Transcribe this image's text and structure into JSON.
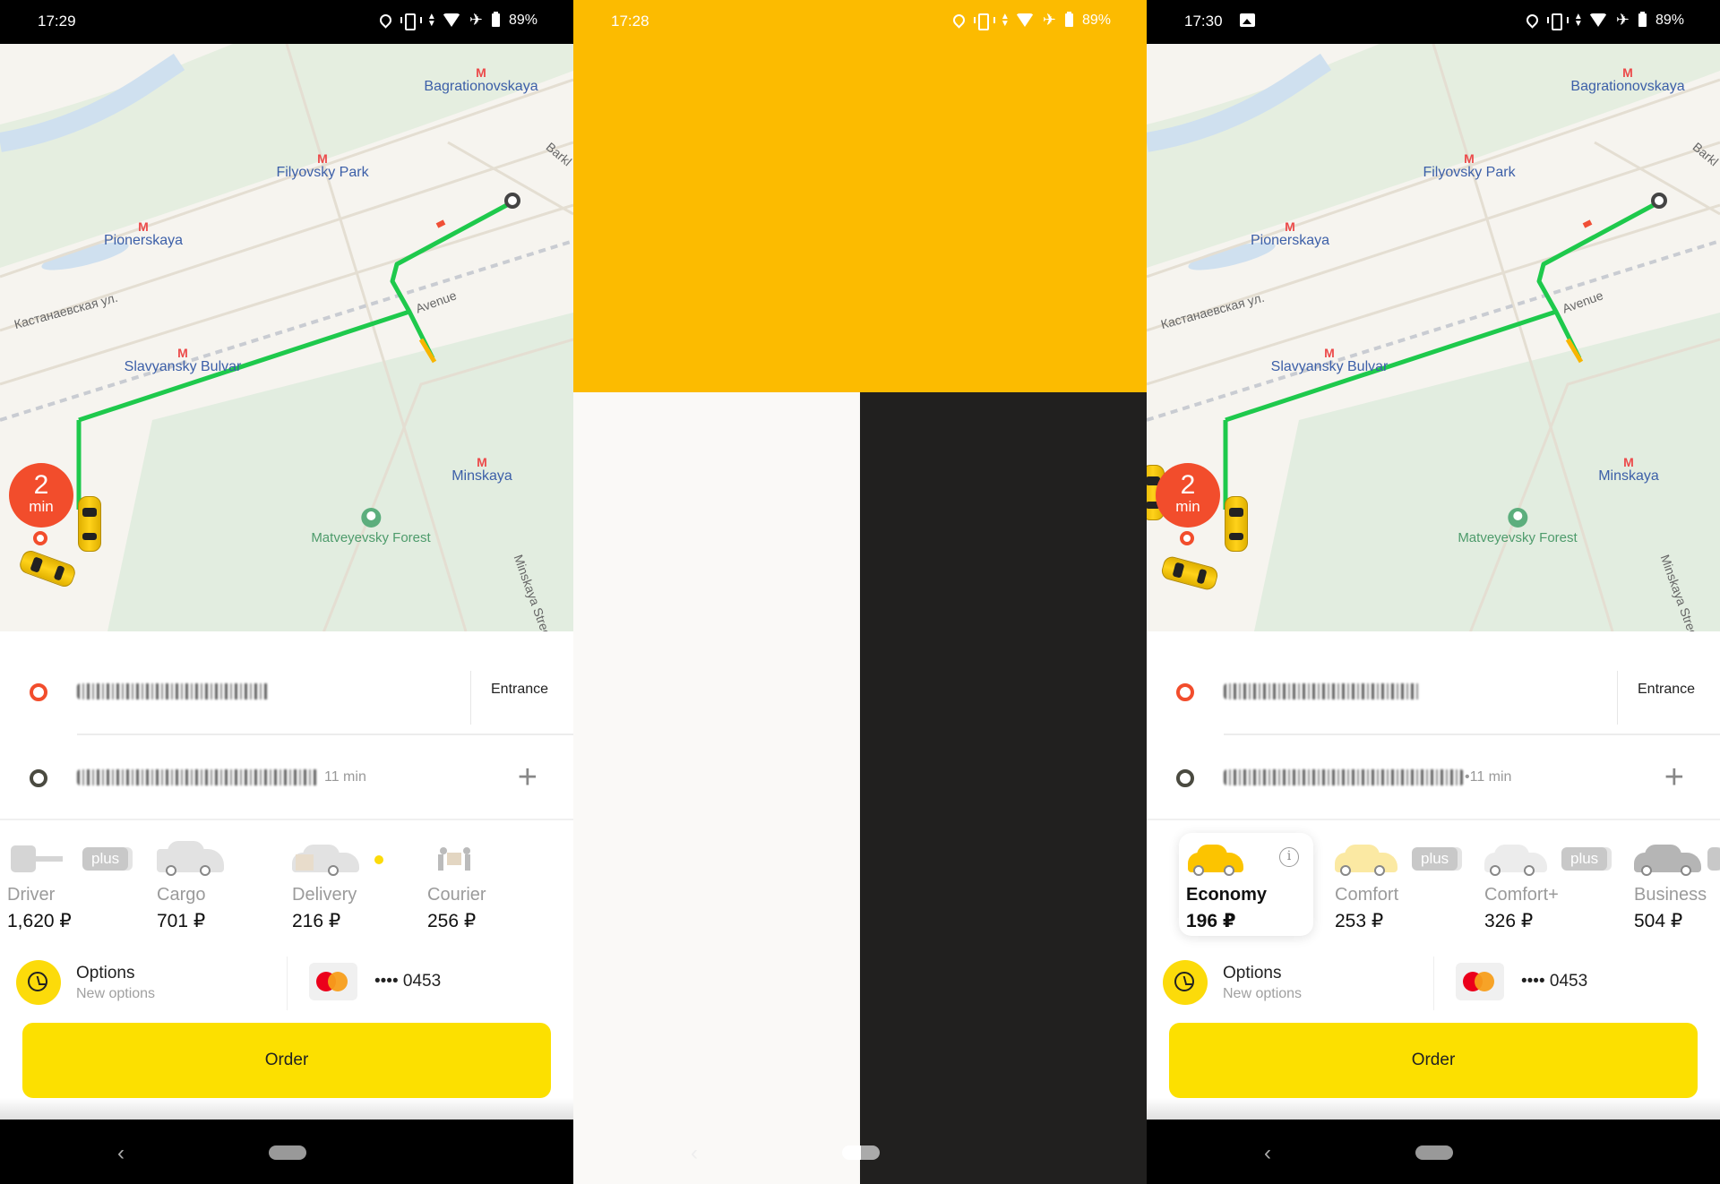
{
  "screens": [
    {
      "status": {
        "time": "17:29",
        "battery": "89%"
      },
      "map": {
        "metro_stations": [
          "Bagrationovskaya",
          "Filyovsky Park",
          "Pionerskaya",
          "Slavyansky Bulvar",
          "Minskaya"
        ],
        "streets": [
          "Кастанаевская ул.",
          "Avenue",
          "Barkl",
          "Minskaya Street"
        ],
        "park": "Matveyevsky Forest",
        "eta": {
          "value": "2",
          "unit": "min"
        }
      },
      "pickup": {
        "address": "[redacted]",
        "entrance_label": "Entrance"
      },
      "destination": {
        "address": "[redacted]",
        "duration": "11 min"
      },
      "tariffs": [
        {
          "name": "Driver",
          "price": "1,620 ₽",
          "badge": "plus",
          "selected": false
        },
        {
          "name": "Cargo",
          "price": "701 ₽",
          "selected": false
        },
        {
          "name": "Delivery",
          "price": "216 ₽",
          "selected": false,
          "new": true
        },
        {
          "name": "Courier",
          "price": "256 ₽",
          "selected": false
        }
      ],
      "options": {
        "title": "Options",
        "subtitle": "New options"
      },
      "payment": {
        "card_masked": "•••• 0453"
      },
      "order_label": "Order"
    },
    {
      "status": {
        "time": "17:28",
        "battery": "89%"
      },
      "splash_colors": {
        "top": "#fcbb00",
        "left": "#faf9f7",
        "right": "#21201f"
      }
    },
    {
      "status": {
        "time": "17:30",
        "battery": "89%"
      },
      "map": {
        "metro_stations": [
          "Bagrationovskaya",
          "Filyovsky Park",
          "Pionerskaya",
          "Slavyansky Bulvar",
          "Minskaya"
        ],
        "streets": [
          "Кастанаевская ул.",
          "Avenue",
          "Barkl",
          "Minskaya Street"
        ],
        "park": "Matveyevsky Forest",
        "eta": {
          "value": "2",
          "unit": "min"
        }
      },
      "pickup": {
        "address": "[redacted]",
        "entrance_label": "Entrance"
      },
      "destination": {
        "address": "[redacted]",
        "duration": "•11 min"
      },
      "tariffs": [
        {
          "name": "Economy",
          "price": "196 ₽",
          "selected": true,
          "info": "i"
        },
        {
          "name": "Comfort",
          "price": "253 ₽",
          "badge": "plus",
          "selected": false
        },
        {
          "name": "Comfort+",
          "price": "326 ₽",
          "badge": "plus",
          "selected": false
        },
        {
          "name": "Business",
          "price": "504 ₽",
          "selected": false
        }
      ],
      "options": {
        "title": "Options",
        "subtitle": "New options"
      },
      "payment": {
        "card_masked": "•••• 0453"
      },
      "order_label": "Order"
    }
  ],
  "colors": {
    "accent_yellow": "#fce000",
    "pickup_red": "#f24d2c",
    "route_green": "#1ec94c",
    "metro_blue": "#3c5fa8",
    "metro_red": "#ec4a4a"
  }
}
